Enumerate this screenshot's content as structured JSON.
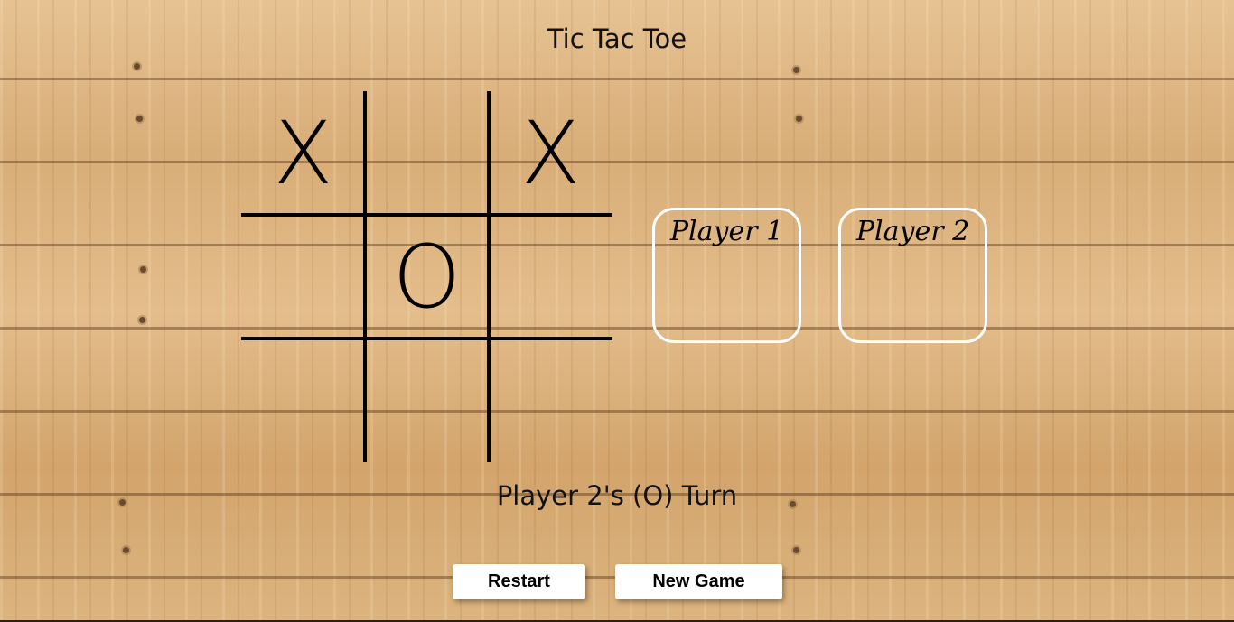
{
  "title": "Tic Tac Toe",
  "board": {
    "cells": [
      "X",
      "",
      "X",
      "",
      "O",
      "",
      "",
      "",
      ""
    ]
  },
  "players": [
    {
      "name": "Player 1"
    },
    {
      "name": "Player 2"
    }
  ],
  "status": "Player 2's (O) Turn",
  "buttons": {
    "restart": "Restart",
    "new_game": "New Game"
  }
}
